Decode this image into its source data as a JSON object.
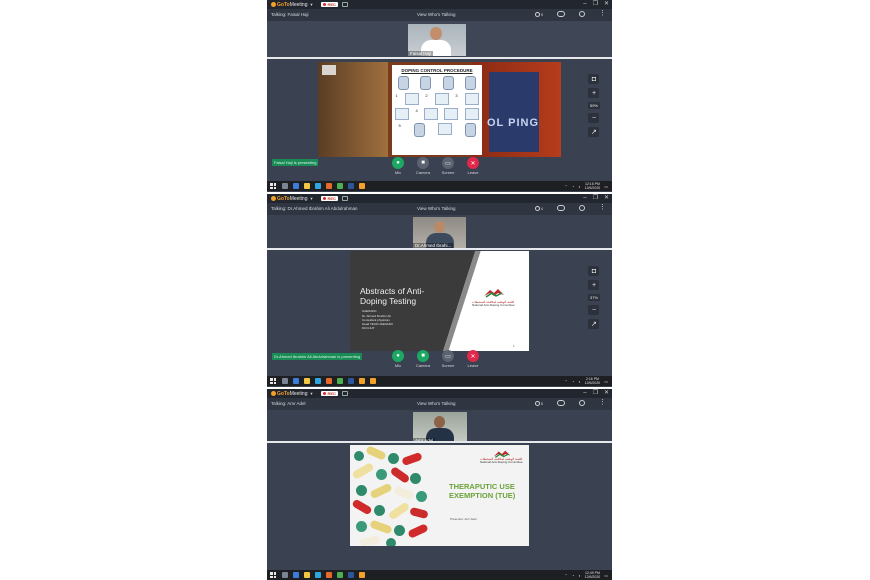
{
  "app": {
    "logo_brand": "GoTo",
    "logo_product": "Meeting",
    "rec_label": "REC"
  },
  "window_controls": [
    "–",
    "❐",
    "✕"
  ],
  "panels": [
    {
      "talking": "Talking: Faisal Haji",
      "view_who": "View Who's Talking",
      "participants": "9",
      "webcam_name": "Faisal Haji",
      "zoom": "59%",
      "presenting": "Faisal Haji is presenting",
      "slide_title": "DOPING CONTROL PROCEDURE",
      "slide_bg_text": "OL PING",
      "slide_nums": [
        "1",
        "2",
        "3",
        "4",
        "5"
      ],
      "clock_time": "12:16 PM",
      "clock_date": "12/6/2020"
    },
    {
      "talking": "Talking: Dr.Ahmed Ibrahim Ali Abdulrahman",
      "view_who": "View Who's Talking",
      "participants": "4",
      "webcam_name": "Dr.Ahmed Ibrahi...",
      "zoom": "37%",
      "presenting": "Dr.Ahmed Ibrahim Ali Abdulrahman is presenting",
      "slide_title": "Abstracts of Anti-Doping Testing",
      "slide_sub": "UAENADC",
      "slide_lines": [
        "Dr. Ahmed Ibrahim Ali",
        "Consultant physician",
        "Head TEU# UAENADC",
        "DCO-IHT"
      ],
      "slide_footer": "1",
      "logo_text": "National Anti-Doping Committee",
      "logo_arabic": "اللجنة الوطنية لمكافحة المنشطات",
      "clock_time": "2:16 PM",
      "clock_date": "12/6/2020"
    },
    {
      "talking": "Talking: Amr Adel",
      "view_who": "View Who's Talking",
      "participants": "5",
      "webcam_name": "Amr Adel",
      "slide_title": "THERAPUTIC USE EXEMPTION (TUE)",
      "slide_presenter": "Presenter: Amr Adel",
      "logo_text": "National Anti-Doping Committee",
      "logo_arabic": "اللجنة الوطنية لمكافحة المنشطات",
      "clock_time": "12:49 PM",
      "clock_date": "12/6/2020"
    }
  ],
  "controls": [
    {
      "label": "Mic",
      "glyph": "●"
    },
    {
      "label": "Camera",
      "glyph": "■"
    },
    {
      "label": "Screen",
      "glyph": "▭"
    },
    {
      "label": "Leave",
      "glyph": "✕"
    }
  ],
  "colors": {
    "brand": "#f4a12a",
    "green": "#1ba862",
    "leave_red": "#e0284a",
    "panel_bg": "#3a4150",
    "tue_green": "#6aa33a"
  }
}
